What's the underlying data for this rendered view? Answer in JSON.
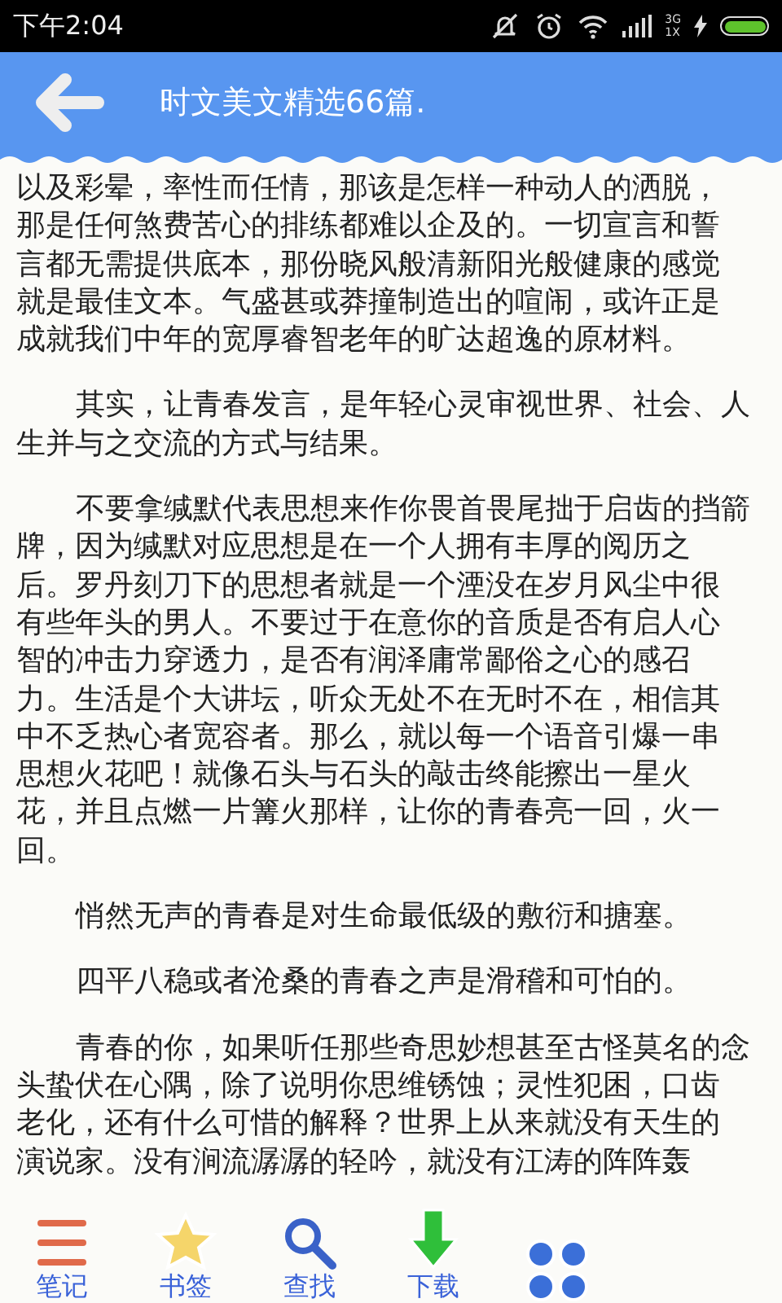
{
  "status_bar": {
    "time": "下午2:04",
    "network_top": "3G",
    "network_bottom": "1X",
    "battery": {
      "level": 1.0
    }
  },
  "header": {
    "title": "时文美文精选66篇."
  },
  "article": {
    "paragraphs": [
      {
        "lines": [
          "以及彩晕，率性而任情，那该是怎样一种动人的洒脱，",
          "那是任何煞费苦心的排练都难以企及的。一切宣言和誓",
          "言都无需提供底本，那份晓风般清新阳光般健康的感觉",
          "就是最佳文本。气盛甚或莽撞制造出的喧闹，或许正是",
          "成就我们中年的宽厚睿智老年的旷达超逸的原材料。"
        ],
        "indent": false
      },
      {
        "lines": [
          "其实，让青春发言，是年轻心灵审视世界、社会、人",
          "生并与之交流的方式与结果。"
        ],
        "indent": true
      },
      {
        "lines": [
          "不要拿缄默代表思想来作你畏首畏尾拙于启齿的挡箭",
          "牌，因为缄默对应思想是在一个人拥有丰厚的阅历之",
          "后。罗丹刻刀下的思想者就是一个湮没在岁月风尘中很",
          "有些年头的男人。不要过于在意你的音质是否有启人心",
          "智的冲击力穿透力，是否有润泽庸常鄙俗之心的感召",
          "力。生活是个大讲坛，听众无处不在无时不在，相信其",
          "中不乏热心者宽容者。那么，就以每一个语音引爆一串",
          "思想火花吧！就像石头与石头的敲击终能擦出一星火",
          "花，并且点燃一片篝火那样，让你的青春亮一回，火一",
          "回。"
        ],
        "indent": true
      },
      {
        "lines": [
          "悄然无声的青春是对生命最低级的敷衍和搪塞。"
        ],
        "indent": true
      },
      {
        "lines": [
          "四平八稳或者沧桑的青春之声是滑稽和可怕的。"
        ],
        "indent": true
      },
      {
        "lines": [
          "青春的你，如果听任那些奇思妙想甚至古怪莫名的念",
          "头蛰伏在心隅，除了说明你思维锈蚀；灵性犯困，口齿",
          "老化，还有什么可惜的解释？世界上从来就没有天生的",
          "演说家。没有涧流潺潺的轻吟，就没有江涛的阵阵轰"
        ],
        "indent": true
      }
    ]
  },
  "toolbar": [
    {
      "kind": "notes",
      "label": "笔记"
    },
    {
      "kind": "bookmark",
      "label": "书签"
    },
    {
      "kind": "search",
      "label": "查找"
    },
    {
      "kind": "download",
      "label": "下载"
    },
    {
      "kind": "more"
    }
  ]
}
